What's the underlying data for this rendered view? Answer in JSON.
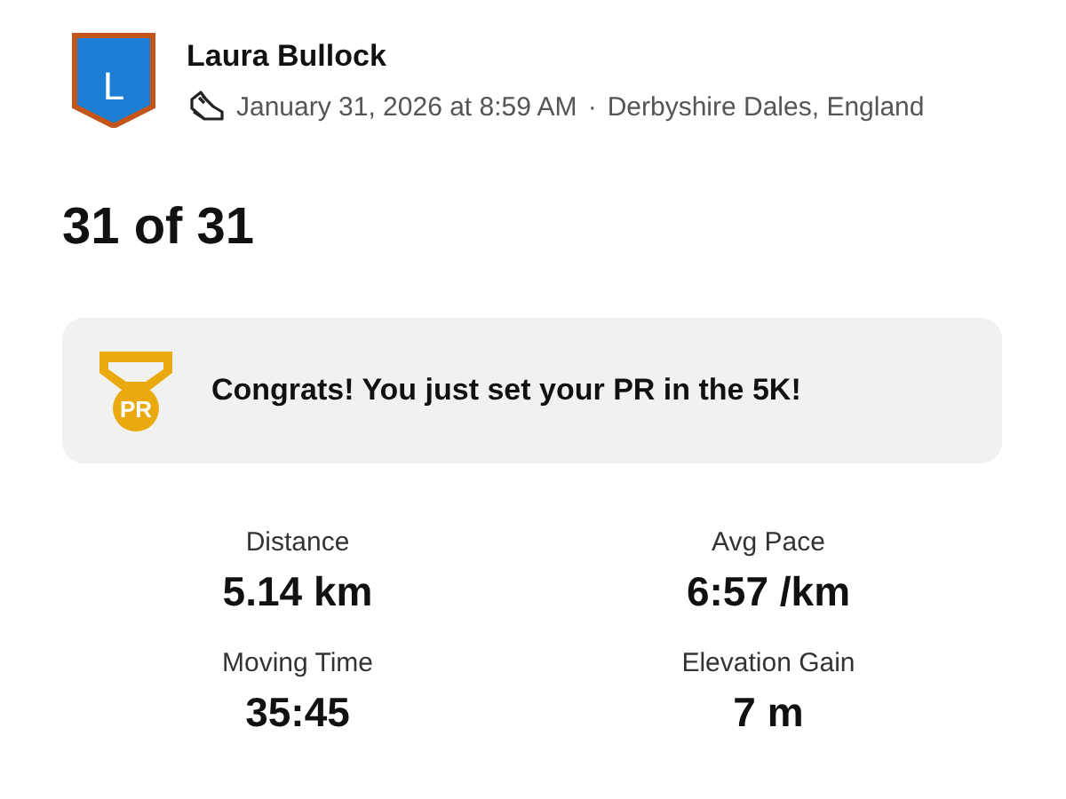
{
  "athlete": {
    "initial": "L",
    "name": "Laura Bullock"
  },
  "activity": {
    "datetime": "January 31, 2026 at 8:59 AM",
    "separator": "·",
    "location": "Derbyshire Dales, England"
  },
  "title": "31 of 31",
  "achievement": {
    "badge": "PR",
    "message": "Congrats! You just set your PR in the 5K!"
  },
  "stats": [
    {
      "label": "Distance",
      "value": "5.14 km"
    },
    {
      "label": "Avg Pace",
      "value": "6:57 /km"
    },
    {
      "label": "Moving Time",
      "value": "35:45"
    },
    {
      "label": "Elevation Gain",
      "value": "7 m"
    }
  ]
}
